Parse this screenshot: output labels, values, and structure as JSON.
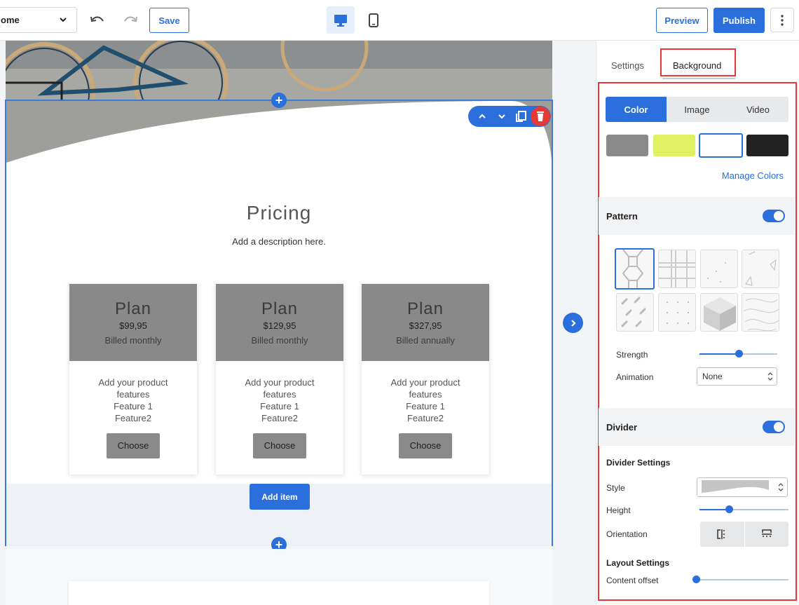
{
  "toolbar": {
    "page_select_value": "ome",
    "save_label": "Save",
    "preview_label": "Preview",
    "publish_label": "Publish"
  },
  "canvas": {
    "title": "Pricing",
    "description": "Add a description here.",
    "add_item_label": "Add item",
    "plans": [
      {
        "name": "Plan",
        "price": "$99,95",
        "billed": "Billed monthly",
        "features": [
          "Add your product",
          "features",
          "Feature 1",
          "Feature2"
        ],
        "button": "Choose"
      },
      {
        "name": "Plan",
        "price": "$129,95",
        "billed": "Billed monthly",
        "features": [
          "Add your product",
          "features",
          "Feature 1",
          "Feature2"
        ],
        "button": "Choose"
      },
      {
        "name": "Plan",
        "price": "$327,95",
        "billed": "Billed annually",
        "features": [
          "Add your product",
          "features",
          "Feature 1",
          "Feature2"
        ],
        "button": "Choose"
      }
    ]
  },
  "panel": {
    "tabs": {
      "settings": "Settings",
      "background": "Background"
    },
    "bg_types": {
      "color": "Color",
      "image": "Image",
      "video": "Video"
    },
    "swatches": [
      "#8a8a8a",
      "#dff061",
      "#ffffff",
      "#222222"
    ],
    "manage_colors": "Manage Colors",
    "pattern": {
      "label": "Pattern",
      "enabled": true,
      "strength_label": "Strength",
      "strength": 0.5,
      "animation_label": "Animation",
      "animation_value": "None"
    },
    "divider": {
      "label": "Divider",
      "enabled": true,
      "settings_label": "Divider Settings",
      "style_label": "Style",
      "height_label": "Height",
      "height": 0.33,
      "orientation_label": "Orientation",
      "layout_label": "Layout Settings",
      "content_offset_label": "Content offset",
      "content_offset": 0
    },
    "accent": "#2a6fdb",
    "highlight": "#e53935"
  }
}
